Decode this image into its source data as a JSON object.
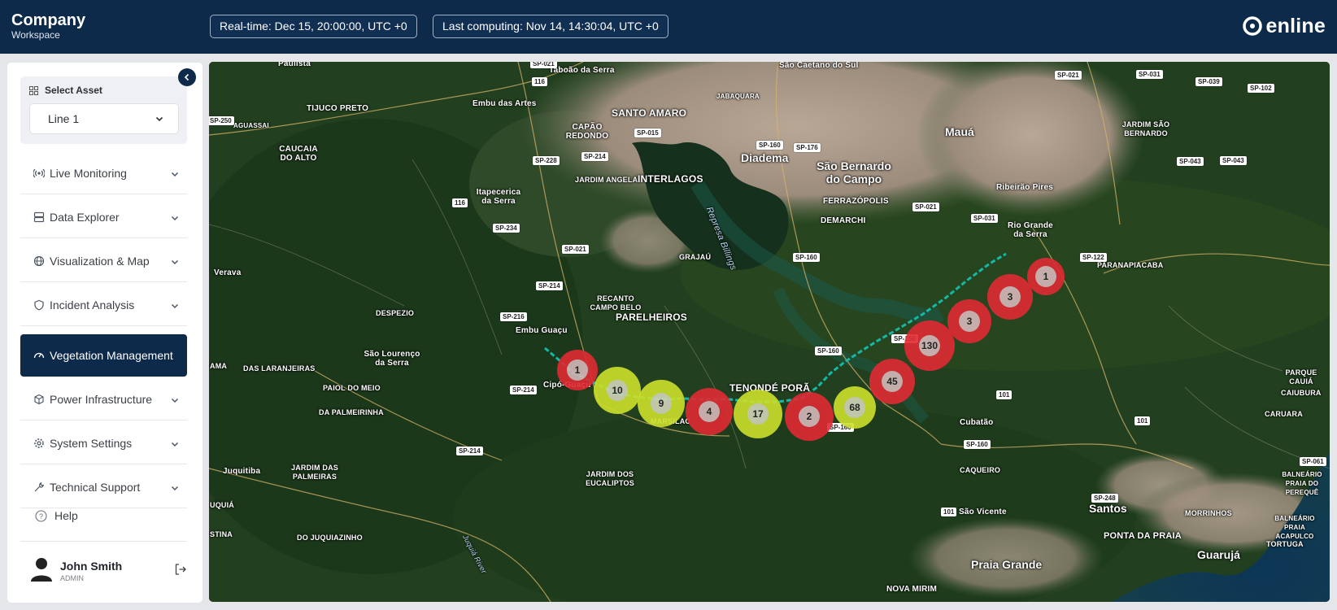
{
  "header": {
    "company": "Company",
    "workspace": "Workspace",
    "realtime": "Real-time: Dec 15, 20:00:00, UTC +0",
    "last_computing": "Last computing: Nov 14, 14:30:04, UTC +0",
    "logo_text": "enline"
  },
  "sidebar": {
    "select_asset_label": "Select Asset",
    "asset_value": "Line 1",
    "items": [
      {
        "label": "Live Monitoring",
        "icon": "broadcast-icon"
      },
      {
        "label": "Data Explorer",
        "icon": "database-icon"
      },
      {
        "label": "Visualization & Map",
        "icon": "globe-icon"
      },
      {
        "label": "Incident Analysis",
        "icon": "shield-icon"
      },
      {
        "label": "Vegetation Management",
        "icon": "gauge-icon",
        "active": true
      },
      {
        "label": "Power Infrastructure",
        "icon": "cube-icon"
      },
      {
        "label": "System Settings",
        "icon": "gear-icon"
      },
      {
        "label": "Technical Support",
        "icon": "wrench-icon"
      }
    ],
    "help": "Help",
    "user": {
      "name": "John Smith",
      "role": "ADMIN"
    }
  },
  "map": {
    "places": [
      "Paulista",
      "Taboão da Serra",
      "São Caetano do Sul",
      "Embu das Artes",
      "SANTO AMARO",
      "JABAQUARA",
      "TIJUCO PRETO",
      "AGUASSAI",
      "CAPÃO REDONDO",
      "CAUCAIA DO ALTO",
      "Diadema",
      "São Bernardo do Campo",
      "Mauá",
      "JARDIM ANGELA",
      "INTERLAGOS",
      "Itapecerica da Serra",
      "FERRAZÓPOLIS",
      "DEMARCHI",
      "Ribeirão Pires",
      "Rio Grande da Serra",
      "PARANAPIACABA",
      "JARDIM SÃO BERNARDO",
      "Represa Billings",
      "GRAJAÚ",
      "Verava",
      "RECANTO CAMPO BELO",
      "PARELHEIROS",
      "DESPEZIO",
      "Embu Guaçu",
      "São Lourenço da Serra",
      "DAS LARANJEIRAS",
      "PAIOL DO MEIO",
      "Cipó-Guaçu",
      "TENONDÉ PORÃ",
      "MARSILAC",
      "DA PALMEIRINHA",
      "Juquitiba",
      "JARDIM DAS PALMEIRAS",
      "JARDIM DOS EUCALIPTOS",
      "Cubatão",
      "CAQUEIRO",
      "São Vicente",
      "Santos",
      "PONTA DA PRAIA",
      "Guarujá",
      "Praia Grande",
      "NOVA MIRIM",
      "PARQUE CAUIÁ",
      "CAIUBURA",
      "CARUARA",
      "BALNEÁRIO PRAIA DO PEREQUÊ",
      "MORRINHOS",
      "BALNEÁRIO PRAIA ACAPULCO",
      "TORTUGA",
      "Juquiá River",
      "DO JUQUIAZINHO",
      "UQUIÁ",
      "STINA",
      "AMA"
    ],
    "roads": [
      "SP-021",
      "116",
      "SP-015",
      "SP-228",
      "SP-214",
      "SP-160",
      "SP-176",
      "SP-250",
      "116",
      "SP-234",
      "SP-021",
      "SP-214",
      "SP-216",
      "SP-214",
      "SP-214",
      "SP-160",
      "SP-160",
      "SP-021",
      "SP-031",
      "SP-122",
      "SP-021",
      "SP-031",
      "SP-039",
      "SP-102",
      "SP-043",
      "SP-043",
      "101",
      "101",
      "SP-160",
      "SP-248",
      "101",
      "SP-061",
      "SP-150",
      "SP-160"
    ],
    "incidents": [
      {
        "count": "1",
        "severity": "red"
      },
      {
        "count": "10",
        "severity": "yellow"
      },
      {
        "count": "9",
        "severity": "yellow"
      },
      {
        "count": "4",
        "severity": "red"
      },
      {
        "count": "17",
        "severity": "yellow"
      },
      {
        "count": "2",
        "severity": "red"
      },
      {
        "count": "68",
        "severity": "yellow"
      },
      {
        "count": "45",
        "severity": "red"
      },
      {
        "count": "130",
        "severity": "red"
      },
      {
        "count": "3",
        "severity": "red"
      },
      {
        "count": "3",
        "severity": "red"
      },
      {
        "count": "1",
        "severity": "red"
      }
    ],
    "colors": {
      "red": "#e02a33",
      "yellow": "#cde02c",
      "line": "#14b8a6"
    }
  }
}
